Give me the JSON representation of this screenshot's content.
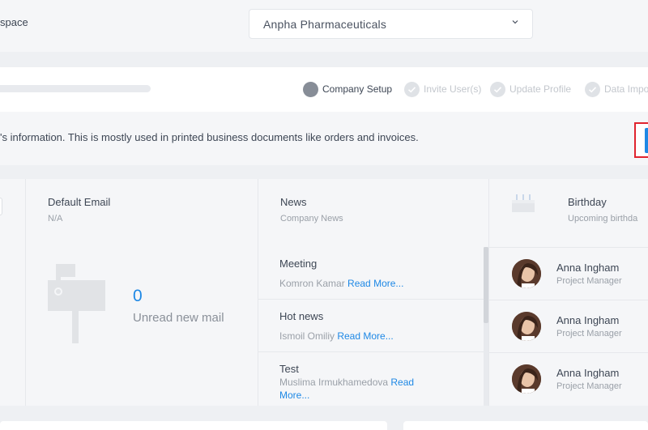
{
  "workspace": {
    "label": "space",
    "selected": "Anpha Pharmaceuticals"
  },
  "steps": [
    {
      "label": "Company Setup",
      "state": "active"
    },
    {
      "label": "Invite User(s)",
      "state": "pending"
    },
    {
      "label": "Update Profile",
      "state": "pending"
    },
    {
      "label": "Data Impo",
      "state": "pending"
    }
  ],
  "info": {
    "text": "'s information. This is mostly used in printed business documents like orders and invoices."
  },
  "email_panel": {
    "title": "Default Email",
    "subtitle": "N/A",
    "unread_count": "0",
    "unread_label": "Unread new mail"
  },
  "news_panel": {
    "title": "News",
    "subtitle": "Company News",
    "items": [
      {
        "title": "Meeting",
        "author": "Komron Kamar",
        "more": "Read More..."
      },
      {
        "title": "Hot news",
        "author": "Ismoil Omiliy",
        "more": "Read More..."
      },
      {
        "title": "Test",
        "author": "Muslima Irmukhamedova",
        "more": "Read More..."
      }
    ]
  },
  "birthday_panel": {
    "title": "Birthday",
    "subtitle": "Upcoming birthda",
    "items": [
      {
        "name": "Anna Ingham",
        "role": "Project Manager"
      },
      {
        "name": "Anna Ingham",
        "role": "Project Manager"
      },
      {
        "name": "Anna Ingham",
        "role": "Project Manager"
      }
    ]
  },
  "colors": {
    "accent": "#1e88e5",
    "highlight": "#e0242f"
  }
}
